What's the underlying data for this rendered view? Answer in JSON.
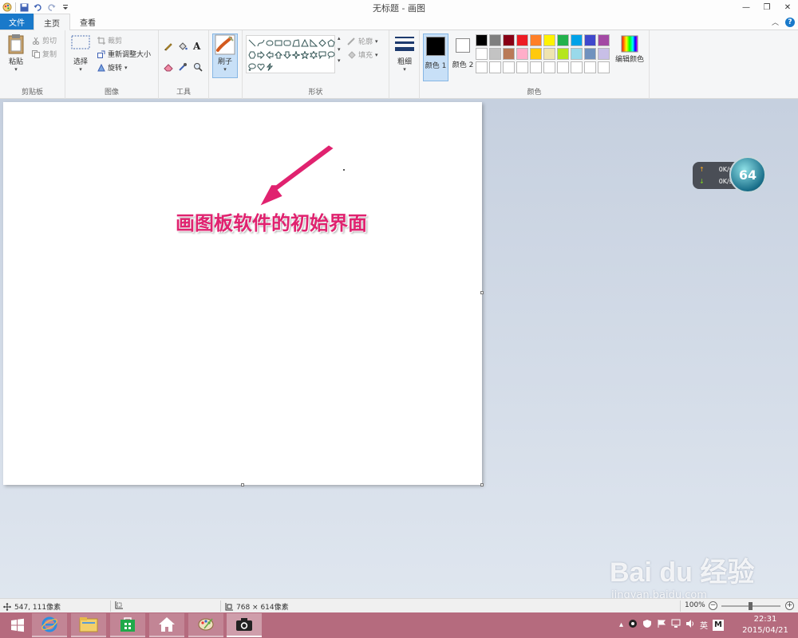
{
  "window": {
    "title": "无标题 - 画图",
    "controls": [
      "—",
      "❐",
      "✕"
    ]
  },
  "tabs": [
    {
      "label": "文件"
    },
    {
      "label": "主页"
    },
    {
      "label": "查看"
    }
  ],
  "ribbon": {
    "clipboard": {
      "paste": "粘贴",
      "cut": "剪切",
      "copy": "复制",
      "label": "剪贴板"
    },
    "image": {
      "select": "选择",
      "crop": "裁剪",
      "resize": "重新调整大小",
      "rotate": "旋转",
      "label": "图像"
    },
    "tools": {
      "label": "工具"
    },
    "brushes": {
      "label": "刷子"
    },
    "shapes": {
      "outline": "轮廓",
      "fill": "填充",
      "label": "形状"
    },
    "size": {
      "label": "粗细"
    },
    "colors": {
      "color1": "颜色 1",
      "color2": "颜色 2",
      "edit": "编辑颜色",
      "label": "颜色",
      "swatches": [
        "#000000",
        "#7f7f7f",
        "#880015",
        "#ed1c24",
        "#ff7f27",
        "#fff200",
        "#22b14c",
        "#00a2e8",
        "#3f48cc",
        "#a349a4",
        "#ffffff",
        "#c3c3c3",
        "#b97a57",
        "#ffaec9",
        "#ffc90e",
        "#efe4b0",
        "#b5e61d",
        "#99d9ea",
        "#7092be",
        "#c8bfe7",
        "#ffffff",
        "#ffffff",
        "#ffffff",
        "#ffffff",
        "#ffffff",
        "#ffffff",
        "#ffffff",
        "#ffffff",
        "#ffffff",
        "#ffffff"
      ]
    }
  },
  "canvas": {
    "annotation": "画图板软件的初始界面"
  },
  "speed_widget": {
    "upload": "0K/s",
    "download": "0K/s",
    "value": "64"
  },
  "watermark": {
    "main": "Bai du 经验",
    "sub": "jingyan.baidu.com"
  },
  "statusbar": {
    "cursor": "547, 111像素",
    "size": "768 × 614像素",
    "zoom": "100%"
  },
  "taskbar": {
    "tray_lang": "英",
    "tray_ime": "M",
    "time": "22:31",
    "date": "2015/04/21"
  }
}
